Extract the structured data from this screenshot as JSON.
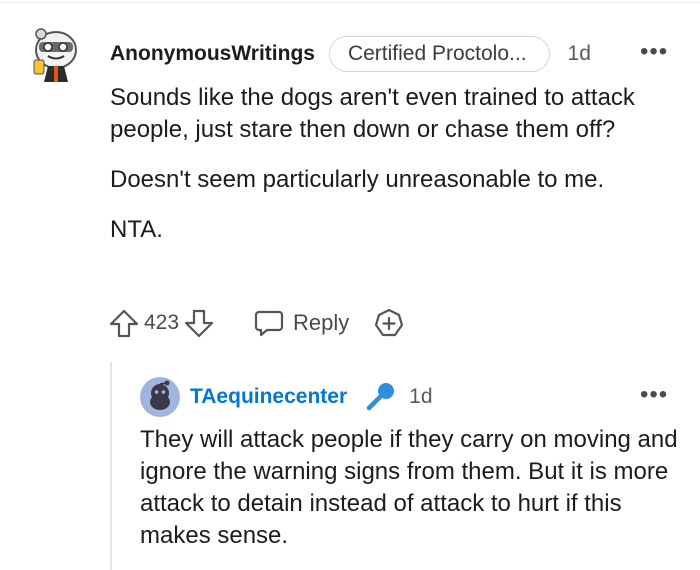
{
  "main_comment": {
    "username": "AnonymousWritings",
    "flair": "Certified Proctolo...",
    "time": "1d",
    "more": "•••",
    "paragraphs": [
      "Sounds like the dogs aren't even trained to attack people, just stare then down or chase them off?",
      "Doesn't seem particularly unreasonable to me.",
      "NTA."
    ],
    "score": "423",
    "reply_label": "Reply"
  },
  "reply_comment": {
    "username": "TAequinecenter",
    "time": "1d",
    "more": "•••",
    "text": "They will attack people if they carry on moving and ignore the warning signs from them. But it is more attack to detain instead of attack to hurt if this makes sense."
  },
  "icons": {
    "upvote": "upvote-icon",
    "downvote": "downvote-icon",
    "reply": "reply-bubble-icon",
    "award": "add-award-icon",
    "mic": "microphone-icon"
  },
  "colors": {
    "reply_username": "#0079d3",
    "mic": "#2f8fdd",
    "avatar_bg": "#9fb5de"
  }
}
